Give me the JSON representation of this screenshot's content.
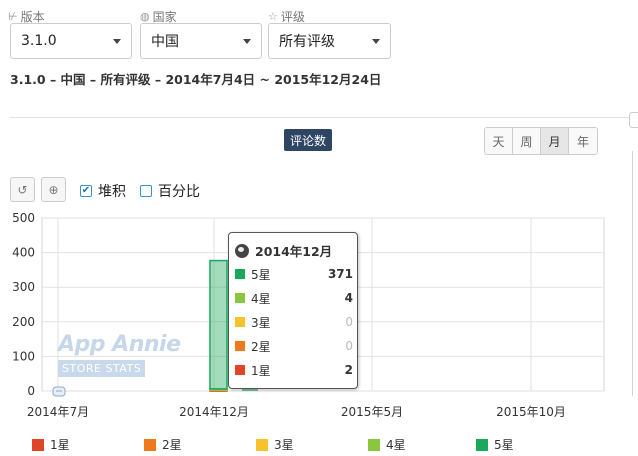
{
  "filters": {
    "version": {
      "label": "版本",
      "value": "3.1.0"
    },
    "country": {
      "label": "国家",
      "value": "中国"
    },
    "rating": {
      "label": "评级",
      "value": "所有评级"
    }
  },
  "summary": "3.1.0 – 中国 – 所有评级 – 2014年7月4日 ~ 2015年12月24日",
  "metric_label": "评论数",
  "periods": [
    "天",
    "周",
    "月",
    "年"
  ],
  "active_period": "月",
  "toolbar": {
    "stacked_label": "堆积",
    "stacked_checked": true,
    "percent_label": "百分比",
    "percent_checked": false
  },
  "watermark": {
    "line1": "App Annie",
    "line2": "STORE STATS"
  },
  "tooltip": {
    "title": "2014年12月",
    "rows": [
      {
        "label": "5星",
        "value": "371",
        "color": "#1aa85b",
        "muted": false
      },
      {
        "label": "4星",
        "value": "4",
        "color": "#8cc63f",
        "muted": false
      },
      {
        "label": "3星",
        "value": "0",
        "color": "#f6c22e",
        "muted": true
      },
      {
        "label": "2星",
        "value": "0",
        "color": "#ee7a1b",
        "muted": true
      },
      {
        "label": "1星",
        "value": "2",
        "color": "#e04527",
        "muted": false
      }
    ]
  },
  "legend": [
    {
      "label": "1星",
      "color": "#e04527"
    },
    {
      "label": "2星",
      "color": "#ee7a1b"
    },
    {
      "label": "3星",
      "color": "#f6c22e"
    },
    {
      "label": "4星",
      "color": "#8cc63f"
    },
    {
      "label": "5星",
      "color": "#1aa85b"
    }
  ],
  "chart_data": {
    "type": "bar",
    "stacked": true,
    "x_ticks": [
      "2014年7月",
      "2014年12月",
      "2015年5月",
      "2015年10月"
    ],
    "y_ticks": [
      "0",
      "100",
      "200",
      "300",
      "400",
      "500"
    ],
    "ylim": [
      0,
      500
    ],
    "categories": [
      "2014年12月"
    ],
    "series": [
      {
        "name": "1星",
        "color": "#e04527",
        "values": [
          2
        ]
      },
      {
        "name": "2星",
        "color": "#ee7a1b",
        "values": [
          0
        ]
      },
      {
        "name": "3星",
        "color": "#f6c22e",
        "values": [
          0
        ]
      },
      {
        "name": "4星",
        "color": "#8cc63f",
        "values": [
          4
        ]
      },
      {
        "name": "5星",
        "color": "#1aa85b",
        "values": [
          371
        ]
      }
    ],
    "grid": true,
    "legend_position": "bottom"
  }
}
